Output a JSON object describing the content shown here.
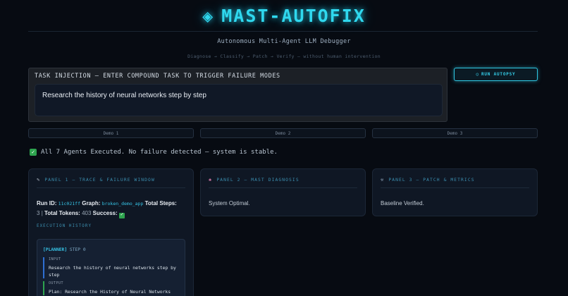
{
  "header": {
    "title": "MAST-AUTOFIX",
    "icon": "diamond-icon",
    "subtitle": "Autonomous Multi-Agent LLM Debugger",
    "tagline": "Diagnose → Classify → Patch → Verify — without human intervention"
  },
  "task": {
    "label": "TASK INJECTION — ENTER COMPOUND TASK TO TRIGGER FAILURE MODES",
    "value": "Research the history of neural networks step by step"
  },
  "run_button": {
    "icon": "circle-icon",
    "label": "RUN AUTOPSY"
  },
  "demos": [
    "Demo 1",
    "Demo 2",
    "Demo 3"
  ],
  "status": {
    "icon": "check-icon",
    "text": "All 7 Agents Executed. No failure detected — system is stable."
  },
  "panel1": {
    "icon": "pin-icon",
    "title": "PANEL 1 — TRACE & FAILURE WINDOW",
    "run_id_label": "Run ID:",
    "run_id": "11c021ff",
    "graph_label": "Graph:",
    "graph": "broken_demo_app",
    "total_steps_label": "Total Steps:",
    "total_steps": "3",
    "separator": "|",
    "total_tokens_label": "Total Tokens:",
    "total_tokens": "403",
    "success_label": "Success:",
    "exec_label": "EXECUTION HISTORY",
    "step": {
      "agent": "[PLANNER]",
      "step_label": "STEP 0",
      "input_label": "INPUT",
      "input": "Research the history of neural networks step by step",
      "output_label": "OUTPUT",
      "output": "Plan: Research the History of Neural Networks"
    }
  },
  "panel2": {
    "icon": "brain-icon",
    "title": "PANEL 2 — MAST DIAGNOSIS",
    "text": "System Optimal."
  },
  "panel3": {
    "icon": "wrench-icon",
    "title": "PANEL 3 — PATCH & METRICS",
    "text": "Baseline Verified."
  },
  "colors": {
    "accent": "#2fd8ee",
    "success": "#2ea44f",
    "background": "#070b12",
    "panel": "#0f1724"
  }
}
